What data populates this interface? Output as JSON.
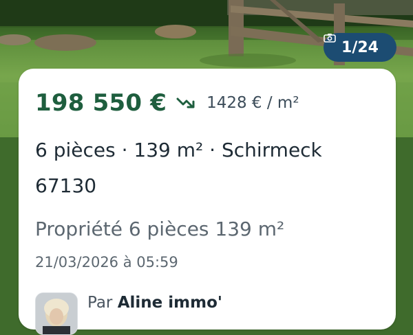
{
  "photo": {
    "counter": "1/24",
    "camera_icon": "camera-icon"
  },
  "listing": {
    "price": "198 550 €",
    "trend_icon": "price-down-trend-icon",
    "price_per_m2": "1428 € / m²",
    "title": "6 pièces · 139 m² · Schirmeck 67130",
    "subtitle": "Propriété 6 pièces 139 m²",
    "date": "21/03/2026 à 05:59"
  },
  "agent": {
    "by": "Par",
    "name": "Aline immo'"
  },
  "colors": {
    "price": "#1e5e3e",
    "badge_bg": "#1c4c72",
    "card_bg": "#ffffff"
  }
}
